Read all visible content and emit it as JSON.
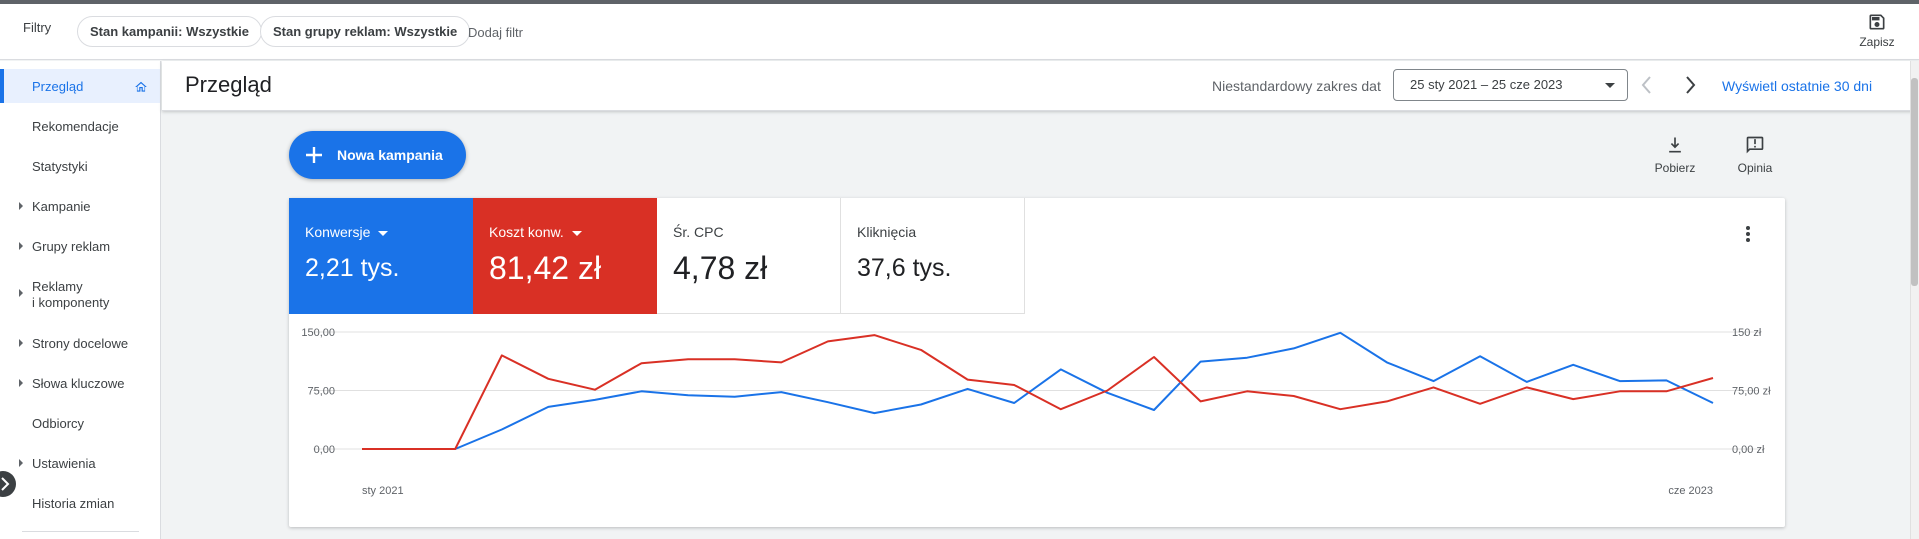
{
  "filterbar": {
    "label": "Filtry",
    "chips": [
      "Stan kampanii: Wszystkie",
      "Stan grupy reklam: Wszystkie"
    ],
    "add_filter": "Dodaj filtr",
    "save_label": "Zapisz"
  },
  "sidebar": {
    "items": [
      {
        "label": "Przegląd",
        "active": true,
        "expandable": false
      },
      {
        "label": "Rekomendacje",
        "active": false,
        "expandable": false
      },
      {
        "label": "Statystyki",
        "active": false,
        "expandable": false
      },
      {
        "label": "Kampanie",
        "active": false,
        "expandable": true
      },
      {
        "label": "Grupy reklam",
        "active": false,
        "expandable": true
      },
      {
        "label": "Reklamy",
        "label2": "i komponenty",
        "active": false,
        "expandable": true
      },
      {
        "label": "Strony docelowe",
        "active": false,
        "expandable": true
      },
      {
        "label": "Słowa kluczowe",
        "active": false,
        "expandable": true
      },
      {
        "label": "Odbiorcy",
        "active": false,
        "expandable": false
      },
      {
        "label": "Ustawienia",
        "active": false,
        "expandable": true
      },
      {
        "label": "Historia zmian",
        "active": false,
        "expandable": false
      }
    ]
  },
  "header": {
    "title": "Przegląd",
    "range_label": "Niestandardowy zakres dat",
    "date_range": "25 sty 2021 – 25 cze 2023",
    "last30": "Wyświetl ostatnie 30 dni"
  },
  "toolbar": {
    "new_campaign": "Nowa kampania",
    "download": "Pobierz",
    "feedback": "Opinia"
  },
  "metrics": [
    {
      "label": "Konwersje",
      "value": "2,21 tys.",
      "color": "#1a73e8",
      "selected": true
    },
    {
      "label": "Koszt konw.",
      "value": "81,42 zł",
      "color": "#d93025",
      "selected": true
    },
    {
      "label": "Śr. CPC",
      "value": "4,78 zł",
      "selected": false
    },
    {
      "label": "Kliknięcia",
      "value": "37,6 tys.",
      "selected": false
    }
  ],
  "colors": {
    "accent": "#1a73e8",
    "red": "#d93025"
  },
  "chart_data": {
    "type": "line",
    "x_start_label": "sty 2021",
    "x_end_label": "cze 2023",
    "left_ticks": [
      "150,00",
      "75,00",
      "0,00"
    ],
    "right_ticks": [
      "150 zł",
      "75,00 zł",
      "0,00 zł"
    ],
    "ylim": [
      0,
      150
    ],
    "grid": true,
    "series": [
      {
        "name": "Konwersje",
        "color": "#1a73e8",
        "values": [
          0,
          0,
          0,
          25,
          54,
          63,
          74,
          69,
          67,
          73,
          60,
          46,
          57,
          77,
          59,
          102,
          72,
          50,
          112,
          117,
          129,
          149,
          111,
          87,
          119,
          86,
          108,
          87,
          88,
          59
        ]
      },
      {
        "name": "Koszt konw.",
        "color": "#d93025",
        "values": [
          0,
          0,
          0,
          120,
          90,
          76,
          110,
          115,
          115,
          111,
          138,
          146,
          127,
          89,
          82,
          51,
          75,
          118,
          61,
          74,
          68,
          51,
          61,
          79,
          58,
          79,
          64,
          74,
          74,
          91
        ]
      }
    ]
  }
}
